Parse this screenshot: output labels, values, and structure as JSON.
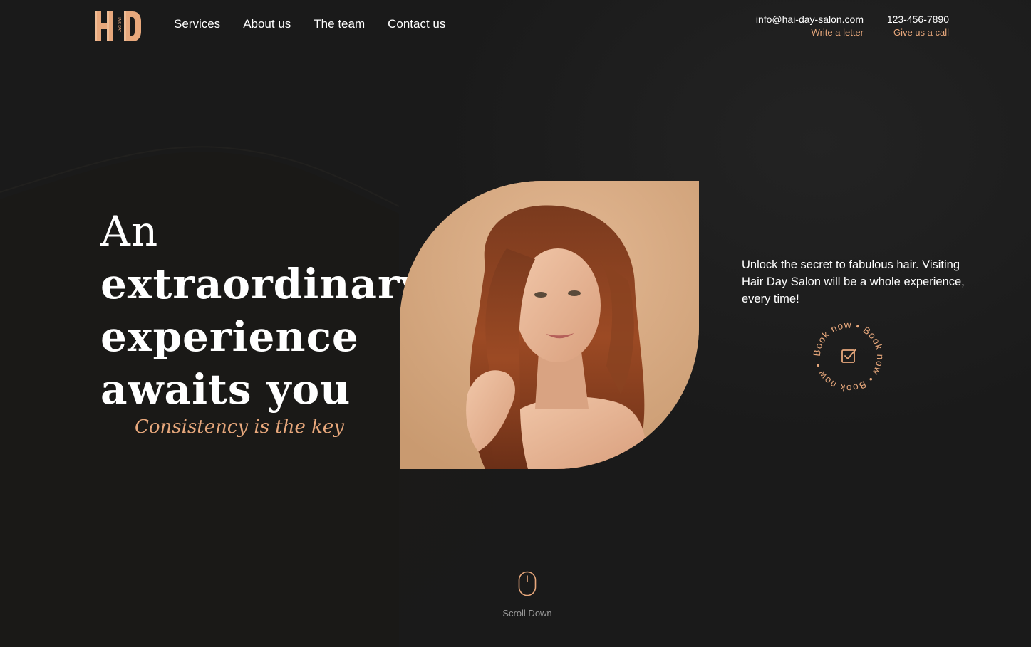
{
  "brand": {
    "logo_letters": "HD",
    "logo_small_text": "HAIR DAY",
    "accent_color": "#e8a87c"
  },
  "nav": {
    "items": [
      {
        "label": "Services"
      },
      {
        "label": "About us"
      },
      {
        "label": "The team"
      },
      {
        "label": "Contact us"
      }
    ]
  },
  "contact": {
    "email": "info@hai-day-salon.com",
    "email_action": "Write a letter",
    "phone": "123-456-7890",
    "phone_action": "Give us a call"
  },
  "hero": {
    "headline_lines": [
      "An",
      "extraordinary",
      "experience",
      "awaits you"
    ],
    "tagline": "Consistency is the key",
    "intro": "Unlock the secret to fabulous hair. Visiting Hair Day Salon will be a whole experience, every time!",
    "book_now_text": "Book now • Book now • Book now •",
    "book_icon": "checkbox-icon"
  },
  "scroll": {
    "label": "Scroll Down",
    "icon": "mouse-icon"
  }
}
